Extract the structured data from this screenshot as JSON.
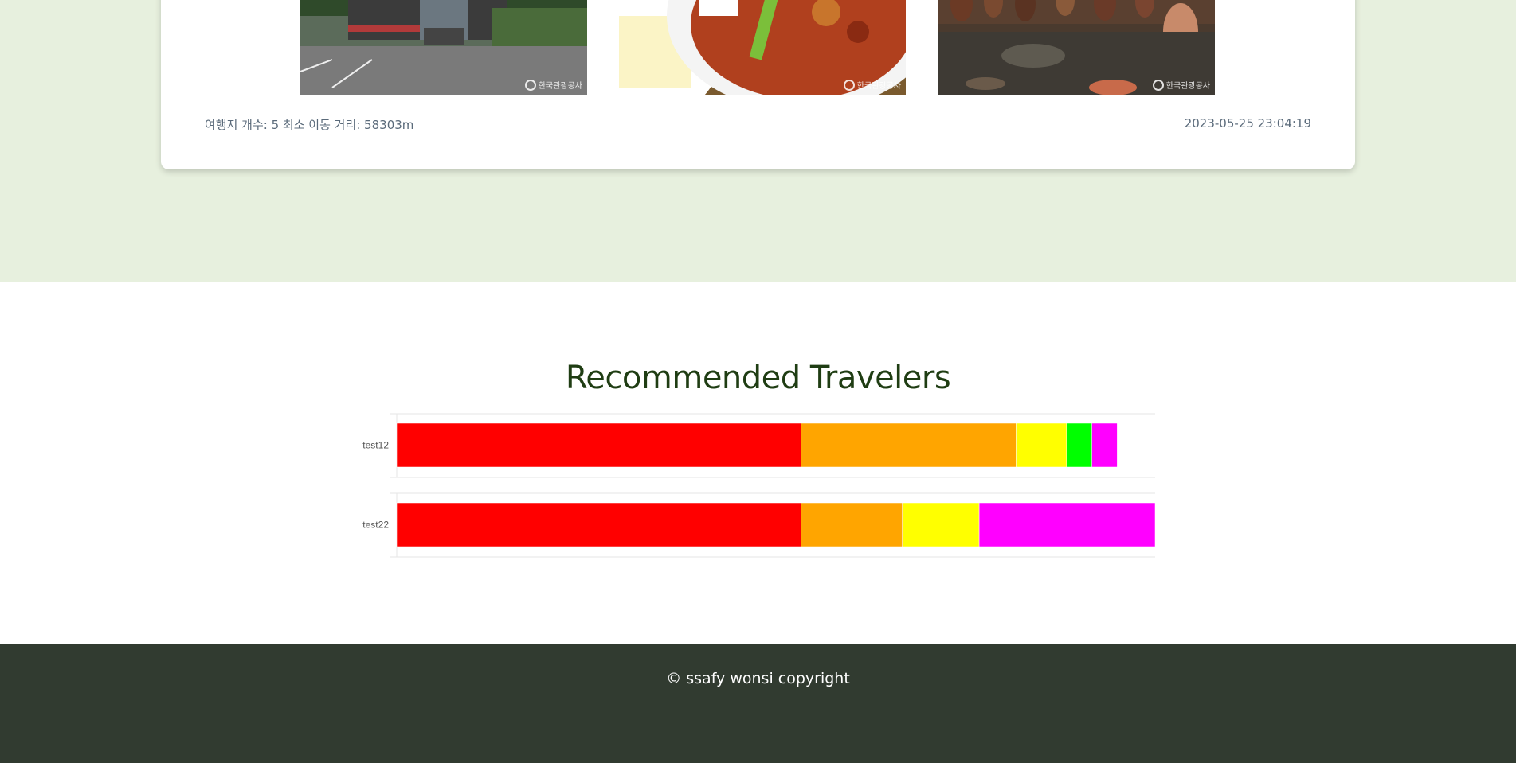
{
  "trip_card": {
    "meta_left": "여행지 개수: 5 최소 이동 거리: 58303m",
    "meta_right": "2023-05-25 23:04:19",
    "photo_watermark": "한국관광공사"
  },
  "recommended": {
    "title": "Recommended Travelers"
  },
  "chart_data": {
    "type": "bar",
    "orientation": "horizontal",
    "stacked": true,
    "categories": [
      "test12",
      "test22"
    ],
    "series": [
      {
        "color": "#ff0000",
        "values": [
          41.6,
          41.6
        ]
      },
      {
        "color": "#ffa500",
        "values": [
          22.1,
          10.4
        ]
      },
      {
        "color": "#ffff00",
        "values": [
          5.2,
          7.9
        ]
      },
      {
        "color": "#00ff00",
        "values": [
          2.6,
          0
        ]
      },
      {
        "color": "#ff00ff",
        "values": [
          2.6,
          18.1
        ]
      }
    ],
    "xlim": [
      0,
      78
    ],
    "grid": true
  },
  "footer": {
    "copyright": "© ssafy wonsi copyright"
  }
}
